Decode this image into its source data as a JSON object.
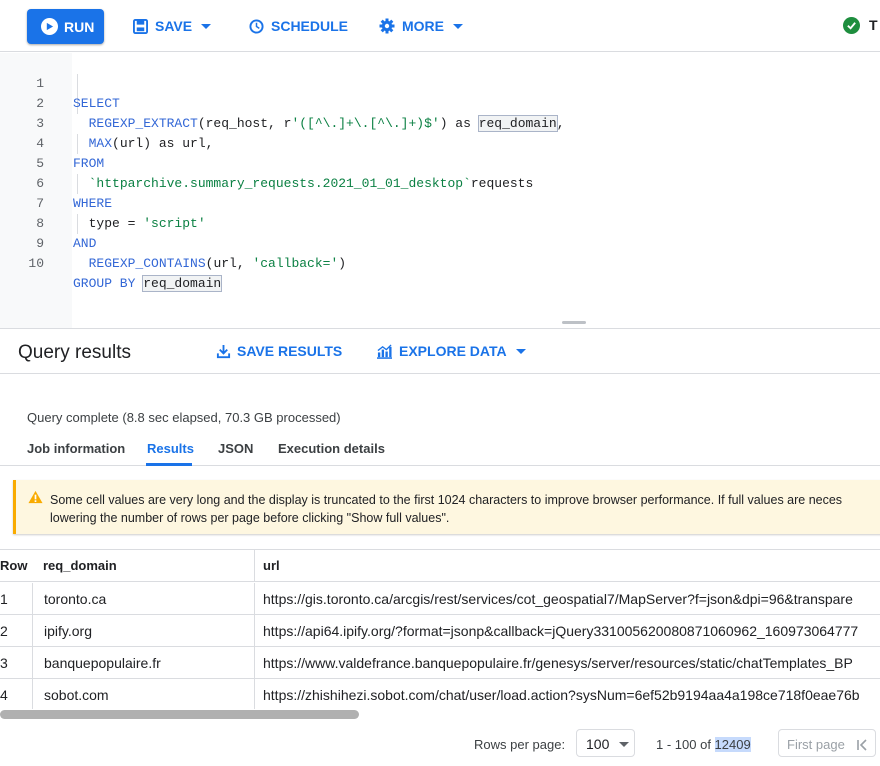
{
  "toolbar": {
    "run_label": "RUN",
    "save_label": "SAVE",
    "schedule_label": "SCHEDULE",
    "more_label": "MORE",
    "status_label": "T"
  },
  "editor": {
    "lines": [
      {
        "num": "1"
      },
      {
        "num": "2"
      },
      {
        "num": "3"
      },
      {
        "num": "4"
      },
      {
        "num": "5"
      },
      {
        "num": "6"
      },
      {
        "num": "7"
      },
      {
        "num": "8"
      },
      {
        "num": "9"
      },
      {
        "num": "10"
      }
    ],
    "code": {
      "select": "SELECT",
      "regexp_extract": "REGEXP_EXTRACT",
      "open_paren_reqhost": "(req_host, r",
      "regex_str": "'([^\\.]+\\.[^\\.]+)$'",
      "close_as": ") as ",
      "req_domain": "req_domain",
      "comma": ",",
      "max": "MAX",
      "max_args": "(url) as url,",
      "from": "FROM",
      "table": "`httparchive.summary_requests.2021_01_01_desktop`",
      "requests": "requests",
      "where": "WHERE",
      "type": "type = ",
      "script_str": "'script'",
      "and": "AND",
      "regexp_contains": "REGEXP_CONTAINS",
      "contains_args": "(url, ",
      "callback_str": "'callback='",
      "close_paren": ")",
      "group_by": "GROUP BY ",
      "group_req_domain": "req_domain"
    }
  },
  "results": {
    "title": "Query results",
    "save_results_label": "SAVE RESULTS",
    "explore_data_label": "EXPLORE DATA",
    "status": "Query complete (8.8 sec elapsed, 70.3 GB processed)",
    "tabs": [
      {
        "label": "Job information"
      },
      {
        "label": "Results"
      },
      {
        "label": "JSON"
      },
      {
        "label": "Execution details"
      }
    ],
    "warning_line1": "Some cell values are very long and the display is truncated to the first 1024 characters to improve browser performance. If full values are neces",
    "warning_line2": "lowering the number of rows per page before clicking \"Show full values\"."
  },
  "table": {
    "headers": {
      "row": "Row",
      "req_domain": "req_domain",
      "url": "url"
    },
    "rows": [
      {
        "row": "1",
        "req_domain": "toronto.ca",
        "url": "https://gis.toronto.ca/arcgis/rest/services/cot_geospatial7/MapServer?f=json&dpi=96&transpare"
      },
      {
        "row": "2",
        "req_domain": "ipify.org",
        "url": "https://api64.ipify.org/?format=jsonp&callback=jQuery331005620080871060962_160973064777"
      },
      {
        "row": "3",
        "req_domain": "banquepopulaire.fr",
        "url": "https://www.valdefrance.banquepopulaire.fr/genesys/server/resources/static/chatTemplates_BP"
      },
      {
        "row": "4",
        "req_domain": "sobot.com",
        "url": "https://zhishihezi.sobot.com/chat/user/load.action?sysNum=6ef52b9194aa4a198ce718f0eae76b"
      }
    ]
  },
  "pager": {
    "rows_per_page_label": "Rows per page:",
    "rows_per_page_value": "100",
    "range_prefix": "1 - 100 of ",
    "total": "12409",
    "first_page_label": "First page"
  }
}
